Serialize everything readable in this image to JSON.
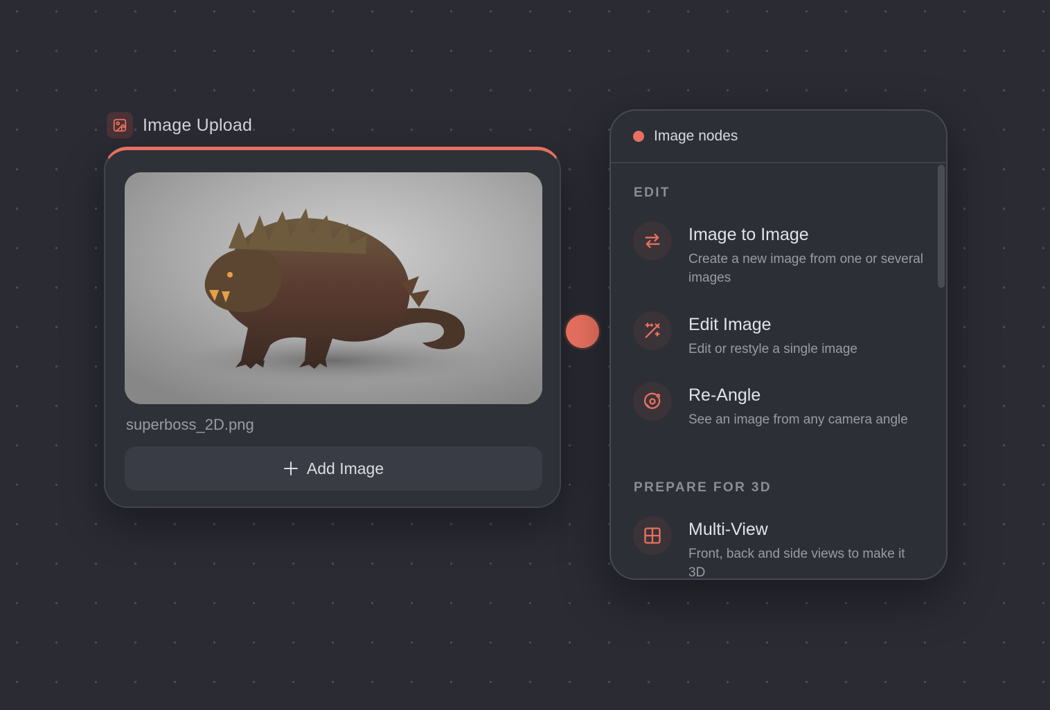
{
  "upload_node": {
    "title": "Image Upload",
    "icon": "image-upload-icon",
    "file_name": "superboss_2D.png",
    "add_button_label": "Add Image",
    "accent_color": "#e8705f"
  },
  "image_menu": {
    "title": "Image nodes",
    "sections": [
      {
        "label": "EDIT",
        "items": [
          {
            "title": "Image to Image",
            "description": "Create a new image from one or several images",
            "icon": "swap-arrows-icon"
          },
          {
            "title": "Edit Image",
            "description": "Edit or restyle a single image",
            "icon": "magic-wand-icon"
          },
          {
            "title": "Re-Angle",
            "description": "See an image from any camera angle",
            "icon": "orbit-icon"
          }
        ]
      },
      {
        "label": "PREPARE FOR 3D",
        "items": [
          {
            "title": "Multi-View",
            "description": "Front, back and side views to make it 3D",
            "icon": "grid-icon"
          }
        ]
      }
    ]
  },
  "colors": {
    "accent": "#e8705f",
    "background": "#2a2b33",
    "panel": "#2d2f37"
  }
}
